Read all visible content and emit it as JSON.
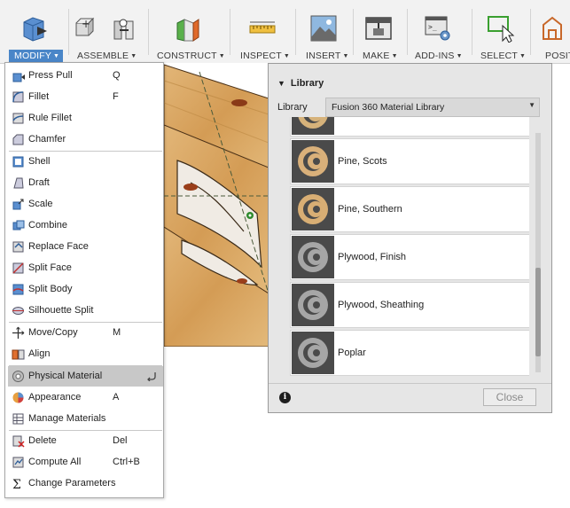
{
  "toolbar": {
    "groups": [
      {
        "label": "MODIFY",
        "icon": "modify-icon"
      },
      {
        "label": "ASSEMBLE",
        "icon": "assemble-icon"
      },
      {
        "label": "CONSTRUCT",
        "icon": "construct-icon"
      },
      {
        "label": "INSPECT",
        "icon": "inspect-icon"
      },
      {
        "label": "INSERT",
        "icon": "insert-icon"
      },
      {
        "label": "MAKE",
        "icon": "make-icon"
      },
      {
        "label": "ADD-INS",
        "icon": "add-ins-icon"
      },
      {
        "label": "SELECT",
        "icon": "select-icon"
      },
      {
        "label": "POSIT",
        "icon": "position-icon"
      }
    ]
  },
  "menu": {
    "items": [
      {
        "label": "Press Pull",
        "shortcut": "Q",
        "icon": "press-pull-icon"
      },
      {
        "label": "Fillet",
        "shortcut": "F",
        "icon": "fillet-icon"
      },
      {
        "label": "Rule Fillet",
        "shortcut": "",
        "icon": "rule-fillet-icon"
      },
      {
        "label": "Chamfer",
        "shortcut": "",
        "icon": "chamfer-icon"
      },
      {
        "label": "Shell",
        "shortcut": "",
        "icon": "shell-icon"
      },
      {
        "label": "Draft",
        "shortcut": "",
        "icon": "draft-icon"
      },
      {
        "label": "Scale",
        "shortcut": "",
        "icon": "scale-icon"
      },
      {
        "label": "Combine",
        "shortcut": "",
        "icon": "combine-icon"
      },
      {
        "label": "Replace Face",
        "shortcut": "",
        "icon": "replace-face-icon"
      },
      {
        "label": "Split Face",
        "shortcut": "",
        "icon": "split-face-icon"
      },
      {
        "label": "Split Body",
        "shortcut": "",
        "icon": "split-body-icon"
      },
      {
        "label": "Silhouette Split",
        "shortcut": "",
        "icon": "silhouette-split-icon"
      },
      {
        "label": "Move/Copy",
        "shortcut": "M",
        "icon": "move-copy-icon"
      },
      {
        "label": "Align",
        "shortcut": "",
        "icon": "align-icon"
      },
      {
        "label": "Physical Material",
        "shortcut": "",
        "icon": "physical-material-icon",
        "highlighted": true
      },
      {
        "label": "Appearance",
        "shortcut": "A",
        "icon": "appearance-icon"
      },
      {
        "label": "Manage Materials",
        "shortcut": "",
        "icon": "manage-materials-icon"
      },
      {
        "label": "Delete",
        "shortcut": "Del",
        "icon": "delete-icon"
      },
      {
        "label": "Compute All",
        "shortcut": "Ctrl+B",
        "icon": "compute-all-icon"
      },
      {
        "label": "Change Parameters",
        "shortcut": "",
        "icon": "change-parameters-icon"
      }
    ]
  },
  "panel": {
    "title": "Library",
    "library_label": "Library",
    "library_value": "Fusion 360 Material Library",
    "materials": [
      {
        "name": "",
        "color": "#d6b27a"
      },
      {
        "name": "Pine, Scots",
        "color": "#d9b07a"
      },
      {
        "name": "Pine, Southern",
        "color": "#d8ae74"
      },
      {
        "name": "Plywood, Finish",
        "color": "#a6a6a6"
      },
      {
        "name": "Plywood, Sheathing",
        "color": "#a6a6a6"
      },
      {
        "name": "Poplar",
        "color": "#a6a6a6"
      }
    ],
    "close_label": "Close",
    "info_icon": "info-icon"
  },
  "colors": {
    "accent": "#4a86c8",
    "wood": "#d9a45a",
    "highlight": "#c8c8c8"
  }
}
